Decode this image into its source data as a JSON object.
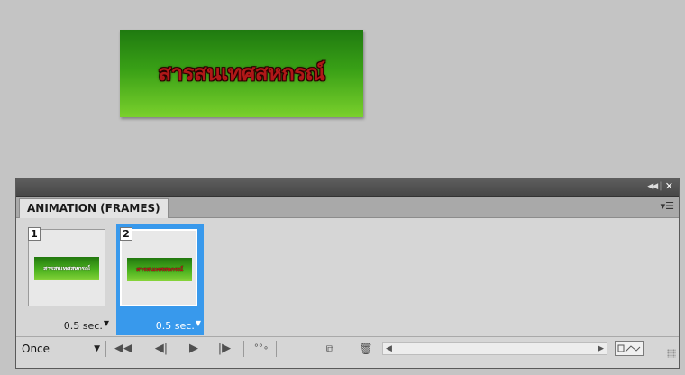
{
  "document": {
    "banner_text": "สารสนเทศสหกรณ์"
  },
  "panel": {
    "tab_label": "ANIMATION (FRAMES)",
    "title_controls": {
      "collapse_icon": "double-chevron-right-icon",
      "close_icon": "close-icon"
    },
    "menu_icon": "panel-menu-icon"
  },
  "frames": [
    {
      "number": "1",
      "delay": "0.5 sec.",
      "thumb_text": "สารสนเทศสหกรณ์",
      "selected": false
    },
    {
      "number": "2",
      "delay": "0.5 sec.",
      "thumb_text": "สารสนเทศสหกรณ์",
      "selected": true
    }
  ],
  "toolbar": {
    "loop_option": "Once",
    "buttons": [
      "first-frame-icon",
      "previous-frame-icon",
      "play-icon",
      "next-frame-icon",
      "tween-icon",
      "duplicate-frame-icon",
      "delete-frame-icon",
      "convert-to-timeline-icon"
    ]
  },
  "colors": {
    "selected_frame": "#3899ec",
    "banner_text": "#b01818",
    "banner_green": "#39a016"
  }
}
